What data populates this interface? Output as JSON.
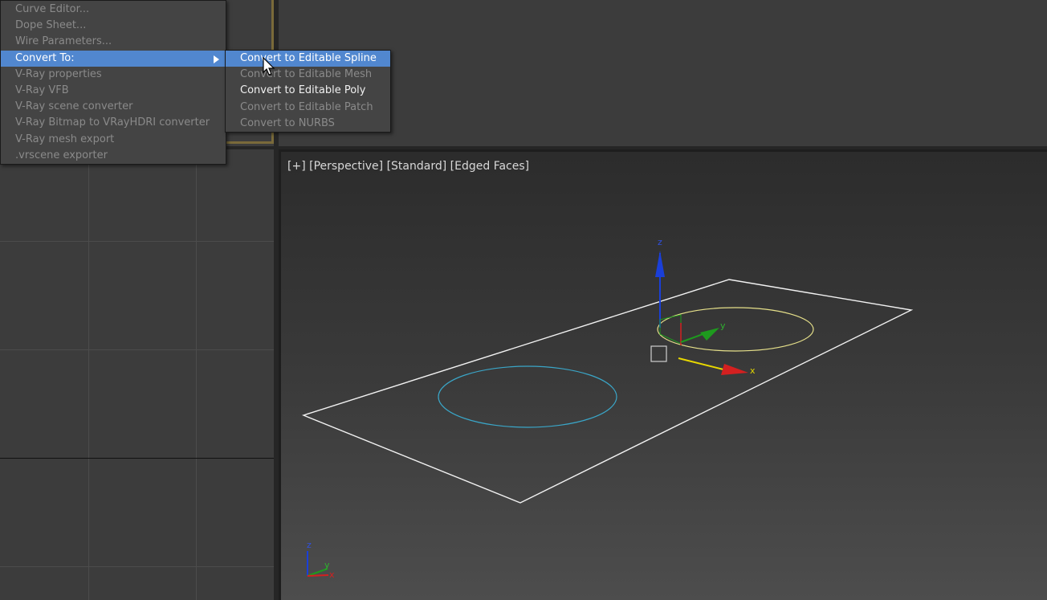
{
  "main_menu": {
    "items": [
      {
        "label": "Curve Editor...",
        "state": "disabled"
      },
      {
        "label": "Dope Sheet...",
        "state": "disabled"
      },
      {
        "label": "Wire Parameters...",
        "state": "disabled"
      },
      {
        "label": "Convert To:",
        "state": "active"
      },
      {
        "label": "V-Ray properties",
        "state": "disabled"
      },
      {
        "label": "V-Ray VFB",
        "state": "disabled"
      },
      {
        "label": "V-Ray scene converter",
        "state": "disabled"
      },
      {
        "label": "V-Ray Bitmap to VRayHDRI converter",
        "state": "disabled"
      },
      {
        "label": "V-Ray mesh export",
        "state": "disabled"
      },
      {
        "label": ".vrscene exporter",
        "state": "disabled"
      }
    ]
  },
  "submenu": {
    "items": [
      {
        "label": "Convert to Editable Spline",
        "state": "active"
      },
      {
        "label": "Convert to Editable Mesh",
        "state": "disabled"
      },
      {
        "label": "Convert to Editable Poly",
        "state": "enabled"
      },
      {
        "label": "Convert to Editable Patch",
        "state": "disabled"
      },
      {
        "label": "Convert to NURBS",
        "state": "disabled"
      }
    ]
  },
  "viewport_label": {
    "plus": "[+]",
    "view": "[Perspective]",
    "shading": "[Standard]",
    "edges": "[Edged Faces]"
  },
  "gizmo_axes": {
    "x": "x",
    "y": "y",
    "z": "z"
  },
  "corner_axes": {
    "x": "x",
    "y": "y",
    "z": "z"
  },
  "colors": {
    "menu_highlight": "#5187cf",
    "plane_wire": "#ffffff",
    "circle_cyan": "#3aa6c8",
    "circle_yellow": "#e6e08a",
    "axis_x": "#d42020",
    "axis_y": "#1e9a1e",
    "axis_z": "#1a3fd8"
  }
}
